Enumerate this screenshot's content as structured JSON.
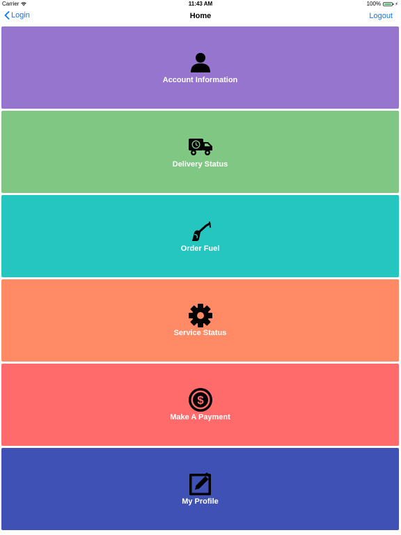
{
  "status_bar": {
    "carrier": "Carrier",
    "time": "11:43 AM",
    "battery": "100%",
    "battery_level": 1.0
  },
  "nav": {
    "back_label": "Login",
    "title": "Home",
    "right_label": "Logout"
  },
  "tiles": [
    {
      "label": "Account Information",
      "color": "#9575cd",
      "icon": "user-icon"
    },
    {
      "label": "Delivery Status",
      "color": "#81c784",
      "icon": "delivery-truck-icon"
    },
    {
      "label": "Order Fuel",
      "color": "#26c6c0",
      "icon": "fuel-nozzle-icon"
    },
    {
      "label": "Service Status",
      "color": "#ff8a65",
      "icon": "gear-icon"
    },
    {
      "label": "Make A Payment",
      "color": "#ff6b6b",
      "icon": "dollar-icon"
    },
    {
      "label": "My Profile",
      "color": "#3f51b5",
      "icon": "edit-icon"
    }
  ]
}
